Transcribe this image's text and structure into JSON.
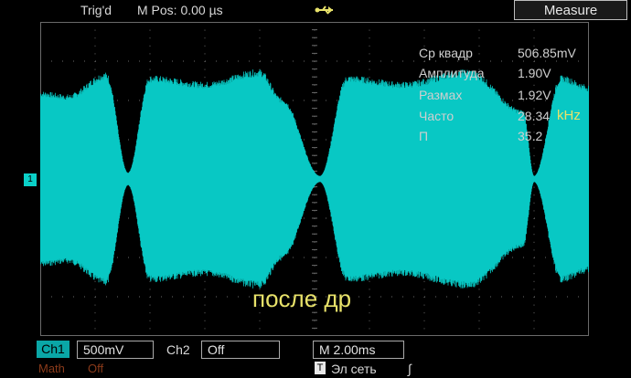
{
  "header": {
    "trig_status": "Trig'd",
    "m_pos_label": "M Pos: 0.00",
    "m_pos_unit": "µs",
    "usb_icon": "usb-icon",
    "measure_tab": "Measure"
  },
  "measurements": [
    {
      "label": "Ср квадр",
      "value": "506.85mV"
    },
    {
      "label": "Амплитуда",
      "value": "1.90V"
    },
    {
      "label": "Размах",
      "value": "1.92V"
    },
    {
      "label": "Часто",
      "value": "28.34"
    },
    {
      "label": "П",
      "value": "35.2"
    }
  ],
  "freq_unit": "kHz",
  "overlay_text": "после др",
  "channel_marker": "1",
  "bottom": {
    "ch1_label": "Ch1",
    "ch1_value": "500mV",
    "ch2_label": "Ch2",
    "ch2_value": "Off",
    "timebase_label": "M 2.00ms",
    "math_label": "Math",
    "math_value": "Off",
    "trigger_tag": "T",
    "trigger_source": "Эл сеть",
    "trigger_slope": "∫"
  },
  "colors": {
    "trace": "#08c8c4",
    "grid": "#6a6a6a",
    "overlay": "#e8e26a"
  }
}
